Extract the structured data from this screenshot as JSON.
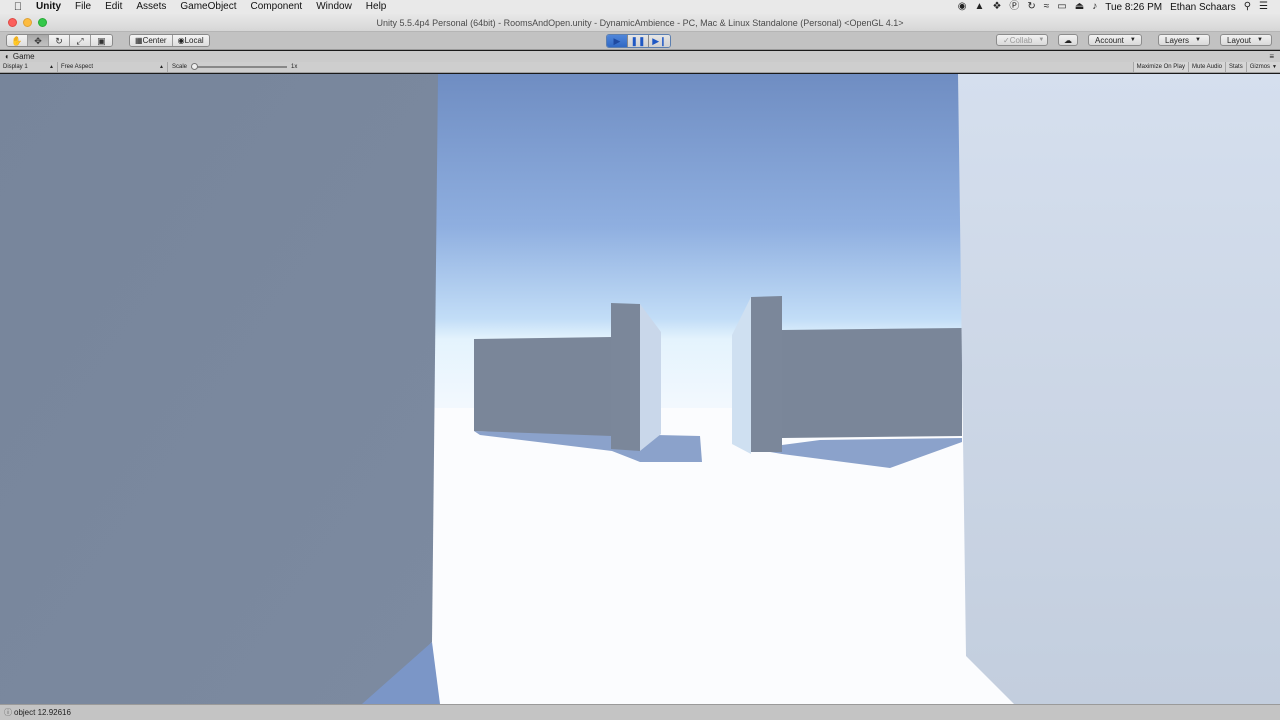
{
  "menubar": {
    "app_name": "Unity",
    "items": [
      "File",
      "Edit",
      "Assets",
      "GameObject",
      "Component",
      "Window",
      "Help"
    ],
    "clock": "Tue 8:26 PM",
    "user": "Ethan Schaars"
  },
  "window": {
    "title": "Unity 5.5.4p4 Personal (64bit) - RoomsAndOpen.unity - DynamicAmbience - PC, Mac & Linux Standalone (Personal) <OpenGL 4.1>"
  },
  "toolbar": {
    "pivot_center": "Center",
    "pivot_local": "Local",
    "collab": "Collab",
    "account": "Account",
    "layers": "Layers",
    "layout": "Layout"
  },
  "game_tab": {
    "label": "Game",
    "display": "Display 1",
    "aspect": "Free Aspect",
    "scale_label": "Scale",
    "scale_value": "1x",
    "maximize_on_play": "Maximize On Play",
    "mute_audio": "Mute Audio",
    "stats": "Stats",
    "gizmos": "Gizmos"
  },
  "status": {
    "message": "object 12.92616"
  },
  "colors": {
    "play_active": "#3b75d1",
    "sky_top": "#6f8fc4",
    "sky_horizon": "#dbeefc",
    "ground": "#fafbfd",
    "wall_shadow": "#7b899f"
  }
}
